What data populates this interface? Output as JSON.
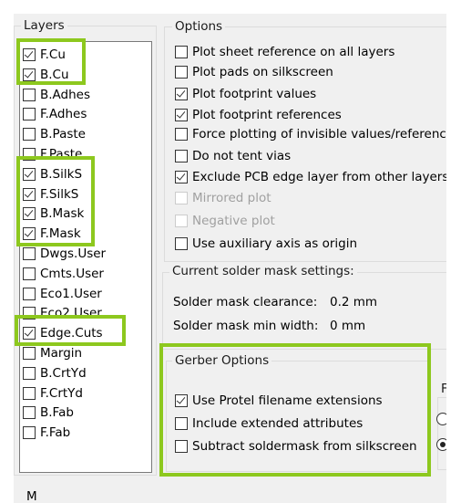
{
  "layers": {
    "title": "Layers",
    "items": [
      {
        "label": "F.Cu",
        "checked": true
      },
      {
        "label": "B.Cu",
        "checked": true
      },
      {
        "label": "B.Adhes",
        "checked": false
      },
      {
        "label": "F.Adhes",
        "checked": false
      },
      {
        "label": "B.Paste",
        "checked": false
      },
      {
        "label": "F.Paste",
        "checked": false
      },
      {
        "label": "B.SilkS",
        "checked": true
      },
      {
        "label": "F.SilkS",
        "checked": true
      },
      {
        "label": "B.Mask",
        "checked": true
      },
      {
        "label": "F.Mask",
        "checked": true
      },
      {
        "label": "Dwgs.User",
        "checked": false
      },
      {
        "label": "Cmts.User",
        "checked": false
      },
      {
        "label": "Eco1.User",
        "checked": false
      },
      {
        "label": "Eco2.User",
        "checked": false
      },
      {
        "label": "Edge.Cuts",
        "checked": true
      },
      {
        "label": "Margin",
        "checked": false
      },
      {
        "label": "B.CrtYd",
        "checked": false
      },
      {
        "label": "F.CrtYd",
        "checked": false
      },
      {
        "label": "B.Fab",
        "checked": false
      },
      {
        "label": "F.Fab",
        "checked": false
      }
    ]
  },
  "options": {
    "title": "Options",
    "items": [
      {
        "label": "Plot sheet reference on all layers",
        "checked": false,
        "disabled": false
      },
      {
        "label": "Plot pads on silkscreen",
        "checked": false,
        "disabled": false
      },
      {
        "label": "Plot footprint values",
        "checked": true,
        "disabled": false
      },
      {
        "label": "Plot footprint references",
        "checked": true,
        "disabled": false
      },
      {
        "label": "Force plotting of invisible values/referenc",
        "checked": false,
        "disabled": false
      },
      {
        "label": "Do not tent vias",
        "checked": false,
        "disabled": false
      },
      {
        "label": "Exclude PCB edge layer from other layers",
        "checked": true,
        "disabled": false
      },
      {
        "label": "Mirrored plot",
        "checked": false,
        "disabled": true
      },
      {
        "label": "Negative plot",
        "checked": false,
        "disabled": true
      },
      {
        "label": "Use auxiliary axis as origin",
        "checked": false,
        "disabled": false
      }
    ]
  },
  "solder_mask": {
    "title": "Current solder mask settings:",
    "clearance_label": "Solder mask clearance:",
    "clearance_value": "0.2 mm",
    "min_width_label": "Solder mask min width:",
    "min_width_value": "0 mm"
  },
  "gerber": {
    "title": "Gerber Options",
    "items": [
      {
        "label": "Use Protel filename extensions",
        "checked": true
      },
      {
        "label": "Include extended attributes",
        "checked": false
      },
      {
        "label": "Subtract soldermask from silkscreen",
        "checked": false
      }
    ]
  },
  "right_group": {
    "title": "F",
    "radio_selected": 1
  },
  "bottom_clipped": "M",
  "highlight_color": "#8dc81e"
}
